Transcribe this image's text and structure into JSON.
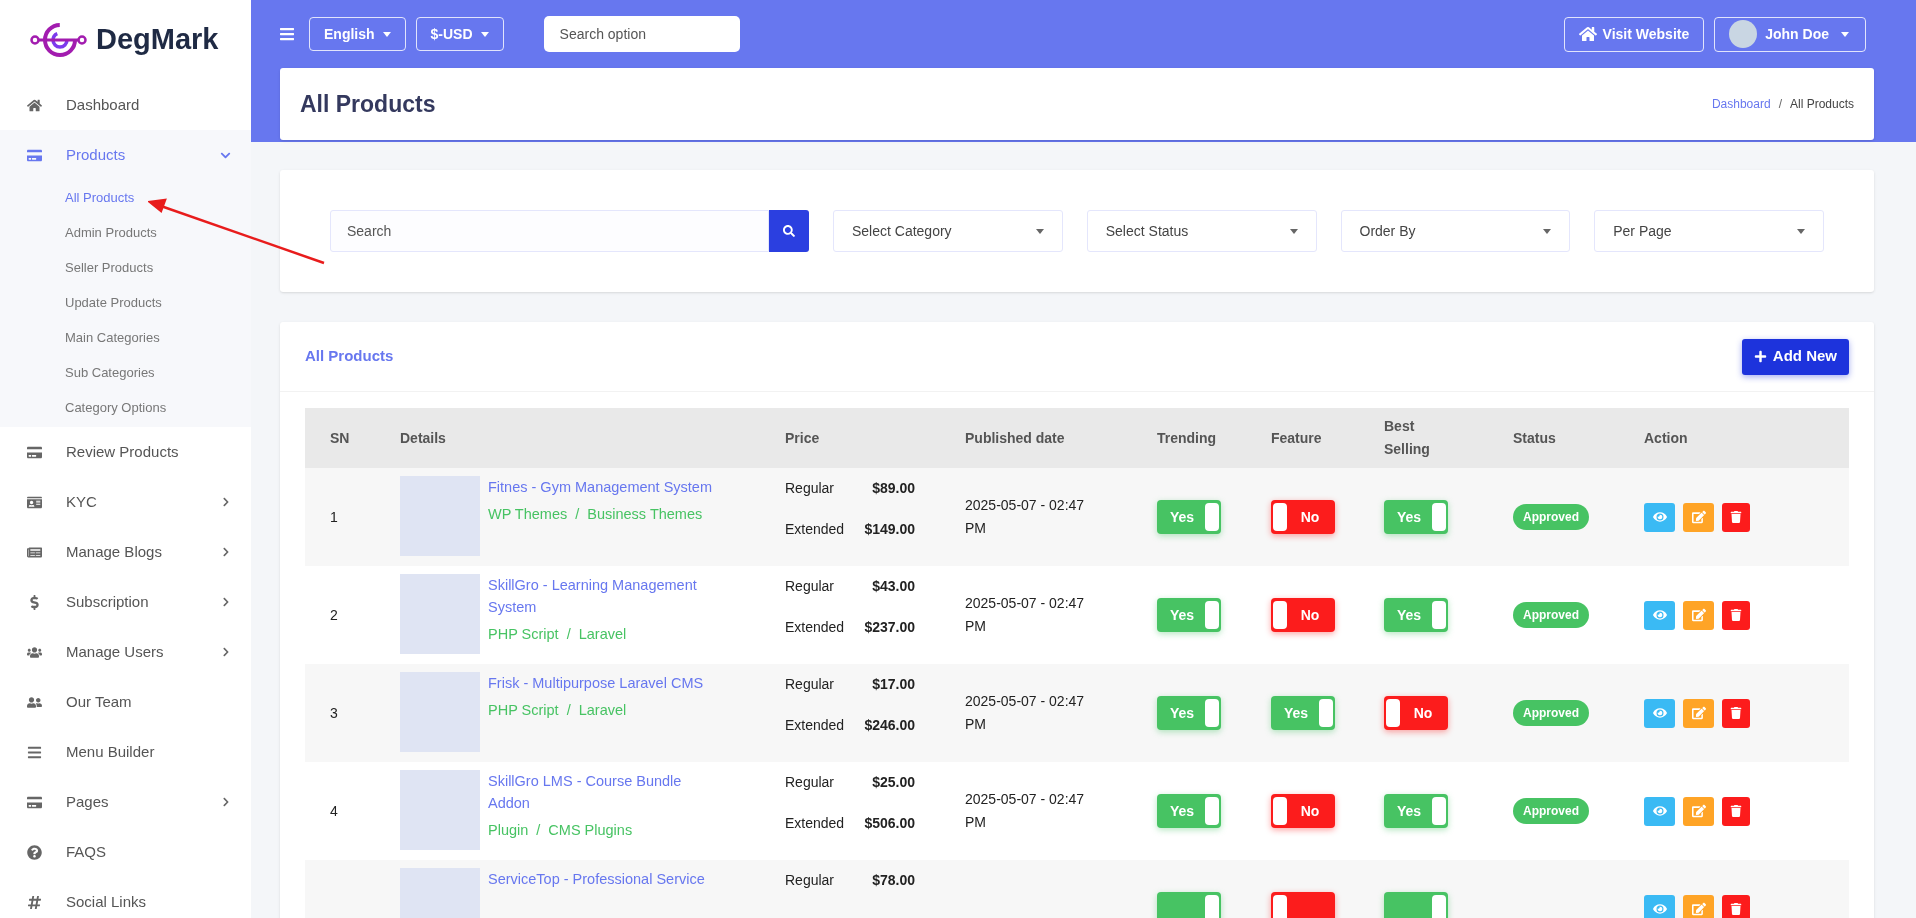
{
  "brand": {
    "name": "DegMark"
  },
  "topbar": {
    "language": "English",
    "currency": "$-USD",
    "search_placeholder": "Search option",
    "visit_button": "Visit Website",
    "user": "John Doe"
  },
  "sidebar": {
    "items": [
      {
        "label": "Dashboard",
        "selected": false
      },
      {
        "label": "Products",
        "selected": true,
        "expandable": true,
        "expanded": true,
        "children": [
          {
            "label": "All Products",
            "selected": true
          },
          {
            "label": "Admin Products",
            "selected": false
          },
          {
            "label": "Seller Products",
            "selected": false
          },
          {
            "label": "Update Products",
            "selected": false
          },
          {
            "label": "Main Categories",
            "selected": false
          },
          {
            "label": "Sub Categories",
            "selected": false
          },
          {
            "label": "Category Options",
            "selected": false
          }
        ]
      },
      {
        "label": "Review Products",
        "selected": false
      },
      {
        "label": "KYC",
        "selected": false,
        "expandable": true,
        "expanded": false
      },
      {
        "label": "Manage Blogs",
        "selected": false,
        "expandable": true,
        "expanded": false
      },
      {
        "label": "Subscription",
        "selected": false,
        "expandable": true,
        "expanded": false
      },
      {
        "label": "Manage Users",
        "selected": false,
        "expandable": true,
        "expanded": false
      },
      {
        "label": "Our Team",
        "selected": false
      },
      {
        "label": "Menu Builder",
        "selected": false
      },
      {
        "label": "Pages",
        "selected": false,
        "expandable": true,
        "expanded": false
      },
      {
        "label": "FAQS",
        "selected": false
      },
      {
        "label": "Social Links",
        "selected": false
      }
    ]
  },
  "page_header": {
    "title": "All Products",
    "separator": "/",
    "breadcrumb": [
      {
        "label": "Dashboard",
        "link": true
      },
      {
        "label": "All Products",
        "link": false
      }
    ]
  },
  "filters": {
    "search_placeholder": "Search",
    "selects": [
      "Select Category",
      "Select Status",
      "Order By",
      "Per Page"
    ]
  },
  "products": {
    "title": "All Products",
    "add_button": "Add New",
    "table": {
      "category_separator": "/",
      "columns": [
        "SN",
        "Details",
        "Price",
        "Published date",
        "Trending",
        "Feature",
        "Best Selling",
        "Status",
        "Action"
      ],
      "rows": [
        {
          "sn": "1",
          "title": "Fitnes - Gym Management System",
          "categories": [
            "WP Themes",
            "Business Themes"
          ],
          "prices": [
            {
              "label": "Regular",
              "value": "$89.00"
            },
            {
              "label": "Extended",
              "value": "$149.00"
            }
          ],
          "date": "2025-05-07 - 02:47 PM",
          "trending": {
            "on": true,
            "label": "Yes"
          },
          "feature": {
            "on": false,
            "label": "No"
          },
          "best_selling": {
            "on": true,
            "label": "Yes"
          },
          "status": "Approved"
        },
        {
          "sn": "2",
          "title": "SkillGro - Learning Management System",
          "categories": [
            "PHP Script",
            "Laravel"
          ],
          "prices": [
            {
              "label": "Regular",
              "value": "$43.00"
            },
            {
              "label": "Extended",
              "value": "$237.00"
            }
          ],
          "date": "2025-05-07 - 02:47 PM",
          "trending": {
            "on": true,
            "label": "Yes"
          },
          "feature": {
            "on": false,
            "label": "No"
          },
          "best_selling": {
            "on": true,
            "label": "Yes"
          },
          "status": "Approved"
        },
        {
          "sn": "3",
          "title": "Frisk - Multipurpose Laravel CMS",
          "categories": [
            "PHP Script",
            "Laravel"
          ],
          "prices": [
            {
              "label": "Regular",
              "value": "$17.00"
            },
            {
              "label": "Extended",
              "value": "$246.00"
            }
          ],
          "date": "2025-05-07 - 02:47 PM",
          "trending": {
            "on": true,
            "label": "Yes"
          },
          "feature": {
            "on": true,
            "label": "Yes"
          },
          "best_selling": {
            "on": false,
            "label": "No"
          },
          "status": "Approved"
        },
        {
          "sn": "4",
          "title": "SkillGro LMS - Course Bundle Addon",
          "categories": [
            "Plugin",
            "CMS Plugins"
          ],
          "prices": [
            {
              "label": "Regular",
              "value": "$25.00"
            },
            {
              "label": "Extended",
              "value": "$506.00"
            }
          ],
          "date": "2025-05-07 - 02:47 PM",
          "trending": {
            "on": true,
            "label": "Yes"
          },
          "feature": {
            "on": false,
            "label": "No"
          },
          "best_selling": {
            "on": true,
            "label": "Yes"
          },
          "status": "Approved"
        },
        {
          "title": "ServiceTop - Professional Service",
          "prices": [
            {
              "label": "Regular",
              "value": "$78.00"
            }
          ],
          "trending": {
            "on": true
          },
          "feature": {
            "on": false
          },
          "best_selling": {
            "on": true
          }
        }
      ]
    }
  }
}
